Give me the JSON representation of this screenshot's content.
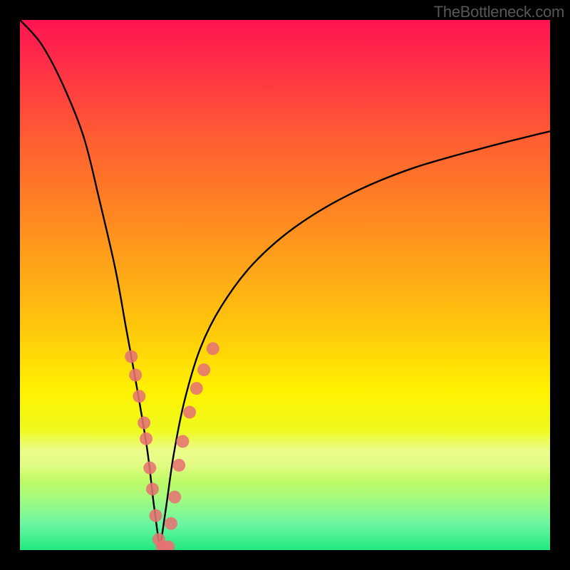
{
  "watermark": {
    "text": "TheBottleneck.com"
  },
  "colors": {
    "background": "#000000",
    "curve": "#000000",
    "marker": "#e57373",
    "gradient_top": "#ff1452",
    "gradient_bottom": "#22e880"
  },
  "chart_data": {
    "type": "line",
    "title": "",
    "xlabel": "",
    "ylabel": "",
    "x_range": [
      0,
      100
    ],
    "y_range": [
      0,
      100
    ],
    "grid": false,
    "legend": false,
    "left_curve": {
      "x": [
        0,
        4,
        8,
        12,
        15,
        18,
        20,
        22,
        24,
        25.2,
        26.4
      ],
      "y": [
        100,
        95.5,
        88,
        78,
        66,
        53,
        42,
        31,
        19,
        9,
        0
      ]
    },
    "right_curve": {
      "x": [
        26.4,
        27.7,
        29,
        31,
        34,
        38,
        44,
        52,
        62,
        74,
        88,
        100
      ],
      "y": [
        0,
        9,
        18,
        28,
        38,
        46,
        54,
        61,
        67,
        72,
        76,
        79
      ]
    },
    "markers_note": "Salmon dots annotate the curves in a band roughly 22%-42% up from the bottom, clustered near and around the minimum.",
    "markers": [
      {
        "x": 21.0,
        "y": 36.5
      },
      {
        "x": 21.8,
        "y": 33.0
      },
      {
        "x": 22.5,
        "y": 29.0
      },
      {
        "x": 23.4,
        "y": 24.0
      },
      {
        "x": 23.8,
        "y": 21.0
      },
      {
        "x": 24.5,
        "y": 15.5
      },
      {
        "x": 25.0,
        "y": 11.5
      },
      {
        "x": 25.6,
        "y": 6.5
      },
      {
        "x": 26.2,
        "y": 2.0
      },
      {
        "x": 26.8,
        "y": 0.6
      },
      {
        "x": 27.4,
        "y": 0.5
      },
      {
        "x": 28.0,
        "y": 0.6
      },
      {
        "x": 28.5,
        "y": 5.0
      },
      {
        "x": 29.2,
        "y": 10.0
      },
      {
        "x": 30.0,
        "y": 16.0
      },
      {
        "x": 30.7,
        "y": 20.5
      },
      {
        "x": 32.0,
        "y": 26.0
      },
      {
        "x": 33.3,
        "y": 30.5
      },
      {
        "x": 34.7,
        "y": 34.0
      },
      {
        "x": 36.4,
        "y": 38.0
      }
    ]
  }
}
